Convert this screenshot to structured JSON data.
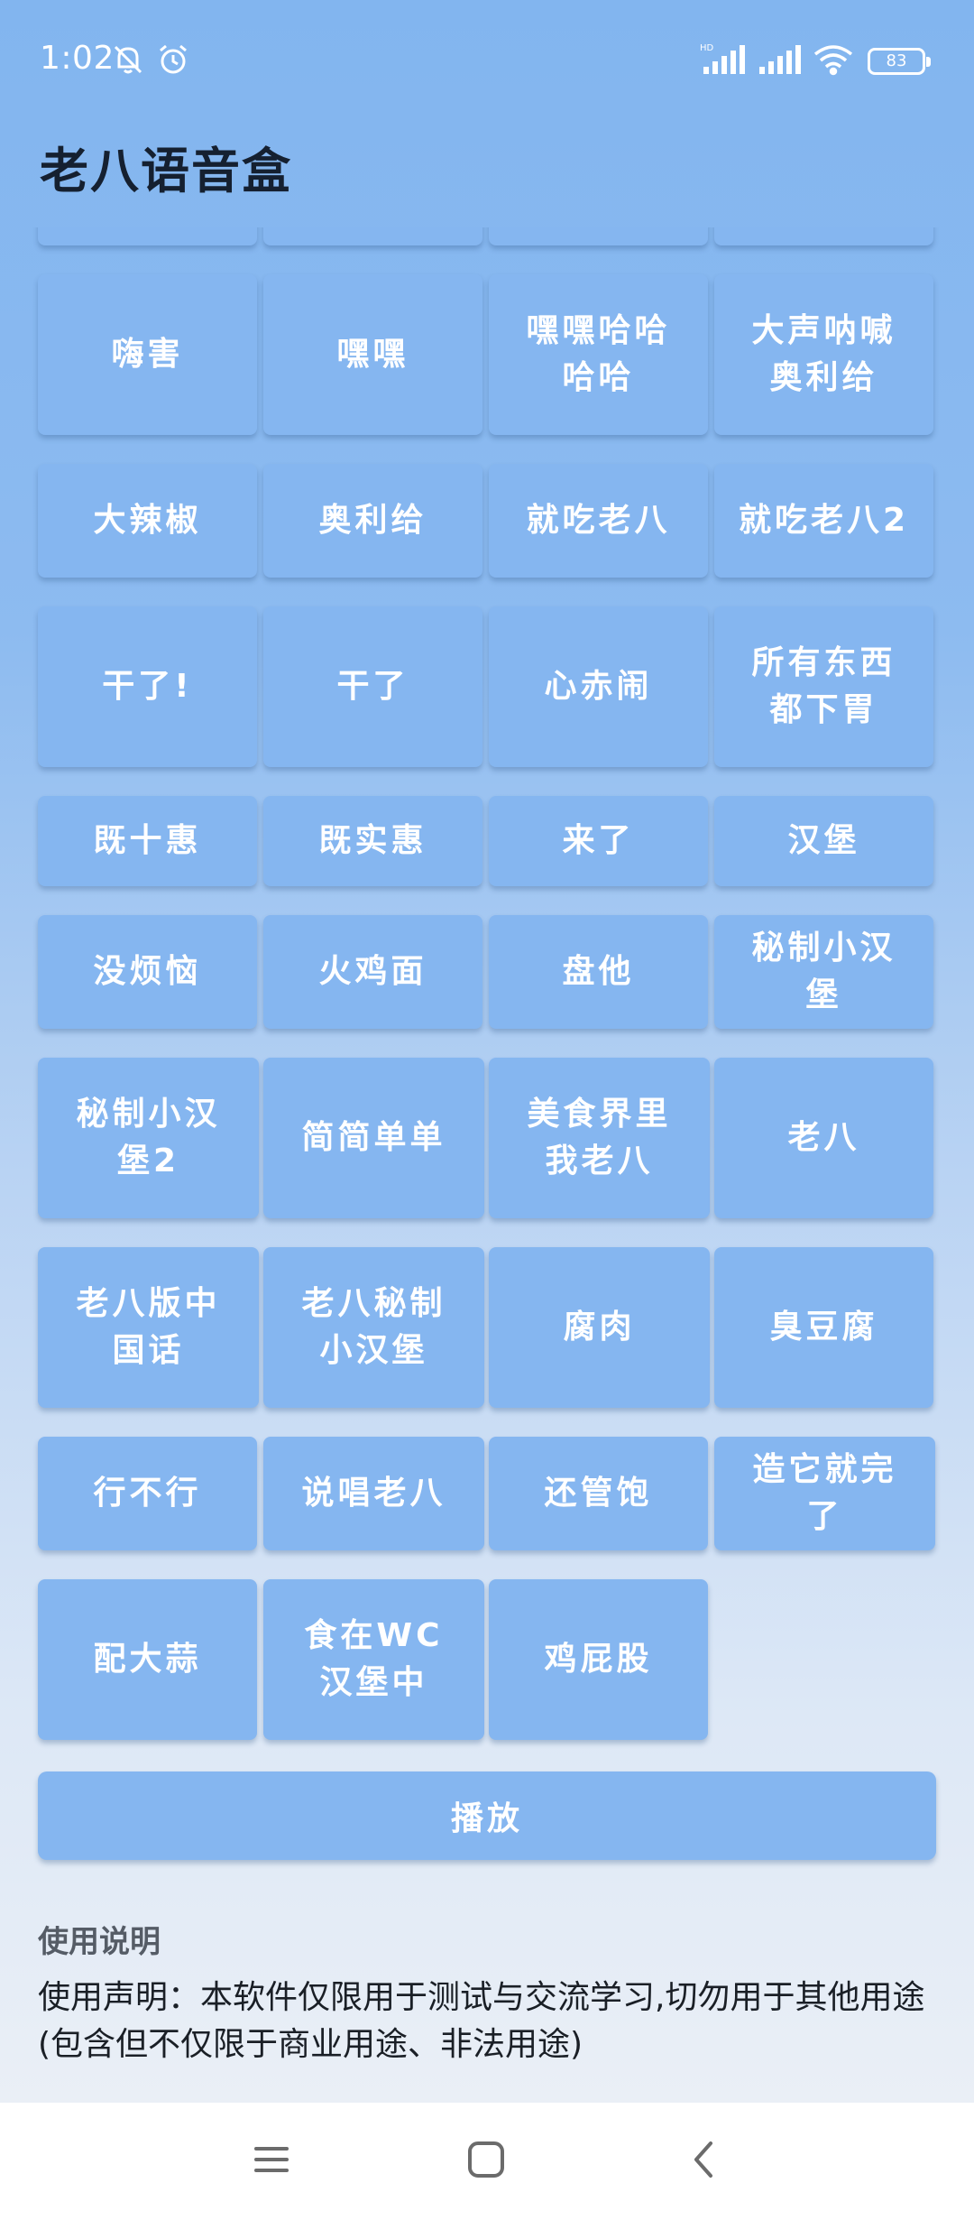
{
  "status_bar": {
    "time": "1:02",
    "battery": "83",
    "icons": [
      "bell-off-icon",
      "alarm-icon",
      "hd-signal-icon",
      "signal-icon",
      "wifi-icon",
      "battery-icon"
    ]
  },
  "app": {
    "title": "老八语音盒"
  },
  "colors": {
    "button": "#85b6f0",
    "button_text": "#ffffff",
    "title": "#152030"
  },
  "sounds": [
    [
      "嗨害",
      "嘿嘿",
      "嘿嘿哈哈哈哈",
      "大声呐喊奥利给"
    ],
    [
      "大辣椒",
      "奥利给",
      "就吃老八",
      "就吃老八2"
    ],
    [
      "干了!",
      "干了",
      "心赤闹",
      "所有东西都下胃"
    ],
    [
      "既十惠",
      "既实惠",
      "来了",
      "汉堡"
    ],
    [
      "没烦恼",
      "火鸡面",
      "盘他",
      "秘制小汉堡"
    ],
    [
      "秘制小汉堡2",
      "简简单单",
      "美食界里我老八",
      "老八"
    ],
    [
      "老八版中国话",
      "老八秘制小汉堡",
      "腐肉",
      "臭豆腐"
    ],
    [
      "行不行",
      "说唱老八",
      "还管饱",
      "造它就完了"
    ],
    [
      "配大蒜",
      "食在WC汉堡中",
      "鸡屁股"
    ]
  ],
  "play_button": {
    "label": "播放"
  },
  "instructions": {
    "heading": "使用说明",
    "text": "使用声明：本软件仅限用于测试与交流学习,切勿用于其他用途(包含但不仅限于商业用途、非法用途)"
  },
  "nav_bar": {
    "icons": [
      "menu-icon",
      "home-icon",
      "back-icon"
    ]
  }
}
